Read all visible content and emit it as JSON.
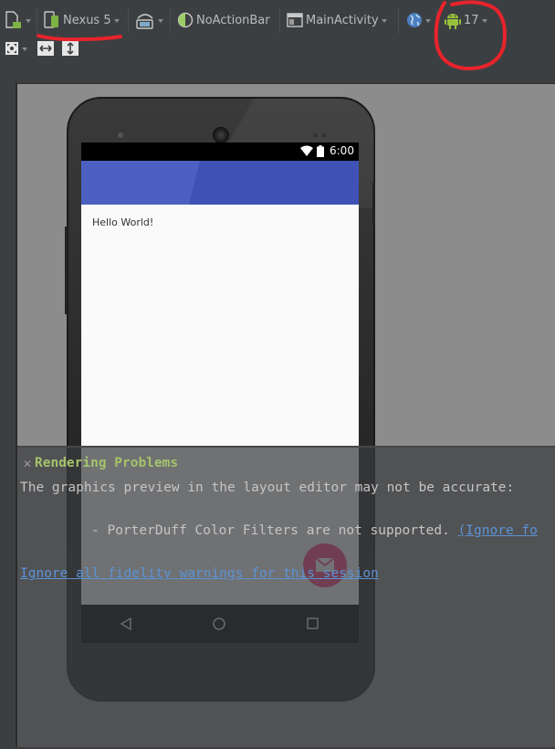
{
  "toolbar": {
    "device": "Nexus 5",
    "theme": "NoActionBar",
    "activity": "MainActivity",
    "api_level": "17"
  },
  "phone": {
    "status_time": "6:00",
    "hello_text": "Hello World!"
  },
  "rendering": {
    "title": "Rendering Problems",
    "description": "The graphics preview in the layout editor may not be accurate:",
    "bullet": "-  PorterDuff Color Filters are not supported.",
    "bullet_link": "(Ignore fo",
    "ignore_link": "Ignore all fidelity warnings for this session"
  },
  "colors": {
    "app_bar": "#4052b5",
    "annotation": "#e8232b",
    "warning_title": "#a4c36b",
    "link": "#5b93d6"
  }
}
